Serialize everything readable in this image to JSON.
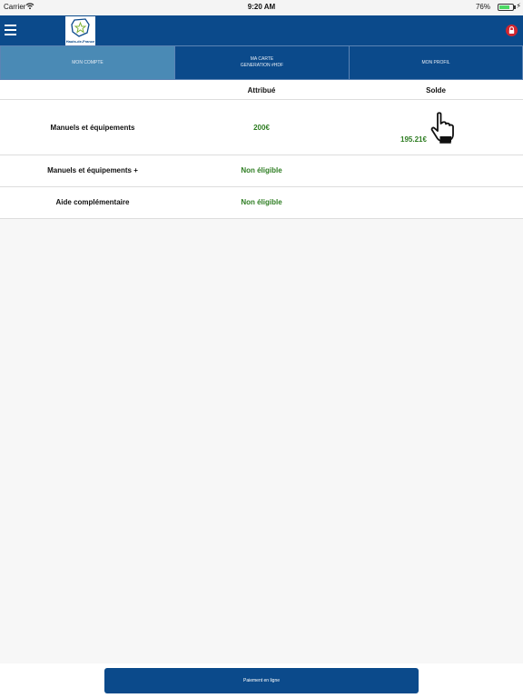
{
  "status": {
    "carrier": "Carrier",
    "time": "9:20 AM",
    "battery": "76%",
    "battery_level": 0.76
  },
  "header": {
    "logo_text": "Hauts-de-France"
  },
  "tabs": [
    {
      "label": "MON COMPTE",
      "active": true
    },
    {
      "label_line1": "MA CARTE",
      "label_line2": "GENERATION #HDF",
      "active": false
    },
    {
      "label": "MON PROFIL",
      "active": false
    }
  ],
  "table": {
    "headers": {
      "attribue": "Attribué",
      "solde": "Solde"
    },
    "rows": [
      {
        "label": "Manuels et équipements",
        "attribue": "200€",
        "solde": "195.21€"
      },
      {
        "label": "Manuels et équipements +",
        "attribue": "Non éligible",
        "solde": ""
      },
      {
        "label": "Aide complémentaire",
        "attribue": "Non éligible",
        "solde": ""
      }
    ]
  },
  "footer": {
    "pay_label": "Paiement en ligne"
  },
  "colors": {
    "brand": "#0b4a8b",
    "active_tab": "#4a8ab5",
    "value_green": "#2e7d22",
    "lock_red": "#d0262f"
  }
}
